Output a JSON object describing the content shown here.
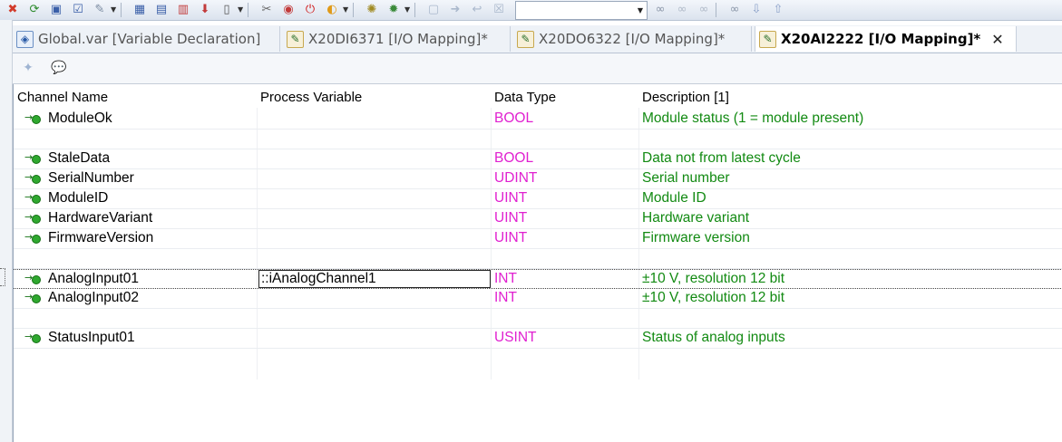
{
  "tabs": [
    {
      "label": "Global.var [Variable Declaration]",
      "icon": "variable-declaration-icon",
      "active": false
    },
    {
      "label": "X20DI6371 [I/O Mapping]*",
      "icon": "io-mapping-icon",
      "active": false
    },
    {
      "label": "X20DO6322 [I/O Mapping]*",
      "icon": "io-mapping-icon",
      "active": false
    },
    {
      "label": "X20AI2222 [I/O Mapping]*",
      "icon": "io-mapping-icon",
      "active": true
    }
  ],
  "table": {
    "columns": [
      "Channel Name",
      "Process Variable",
      "Data Type",
      "Description [1]"
    ],
    "rows": [
      {
        "channel": "ModuleOk",
        "process_variable": "",
        "data_type": "BOOL",
        "description": "Module status (1 = module present)"
      },
      {
        "channel": "",
        "process_variable": "",
        "data_type": "",
        "description": ""
      },
      {
        "channel": "StaleData",
        "process_variable": "",
        "data_type": "BOOL",
        "description": "Data not from latest cycle"
      },
      {
        "channel": "SerialNumber",
        "process_variable": "",
        "data_type": "UDINT",
        "description": "Serial number"
      },
      {
        "channel": "ModuleID",
        "process_variable": "",
        "data_type": "UINT",
        "description": "Module ID"
      },
      {
        "channel": "HardwareVariant",
        "process_variable": "",
        "data_type": "UINT",
        "description": "Hardware variant"
      },
      {
        "channel": "FirmwareVersion",
        "process_variable": "",
        "data_type": "UINT",
        "description": "Firmware version"
      },
      {
        "channel": "",
        "process_variable": "",
        "data_type": "",
        "description": ""
      },
      {
        "channel": "AnalogInput01",
        "process_variable": "::iAnalogChannel1",
        "data_type": "INT",
        "description": "±10 V, resolution 12 bit",
        "selected": true
      },
      {
        "channel": "AnalogInput02",
        "process_variable": "",
        "data_type": "INT",
        "description": "±10 V, resolution 12 bit"
      },
      {
        "channel": "",
        "process_variable": "",
        "data_type": "",
        "description": ""
      },
      {
        "channel": "StatusInput01",
        "process_variable": "",
        "data_type": "USINT",
        "description": "Status of analog inputs"
      }
    ]
  },
  "colors": {
    "data_type": "#e020d0",
    "description": "#128a12",
    "channel_pin": "#2fa82f"
  }
}
